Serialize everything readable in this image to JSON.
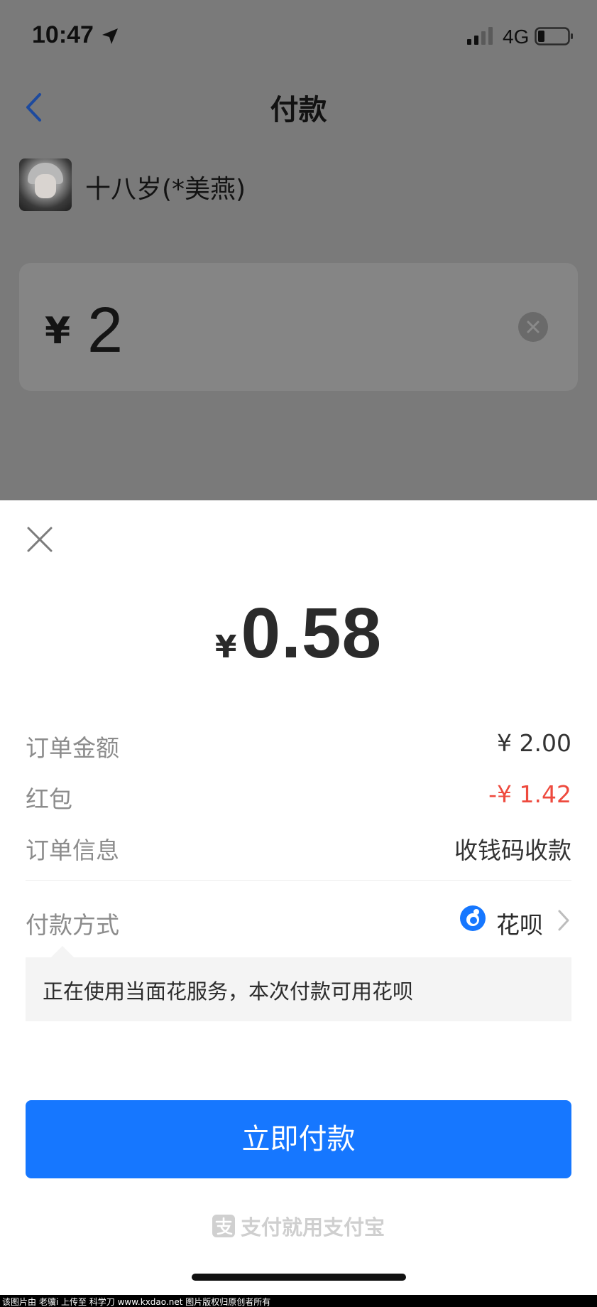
{
  "status_bar": {
    "time": "10:47",
    "network": "4G",
    "icons": [
      "location-arrow-icon",
      "signal-icon",
      "battery-icon"
    ]
  },
  "nav": {
    "title": "付款",
    "back_icon": "chevron-left-icon"
  },
  "payee": {
    "name": "十八岁(*美燕)"
  },
  "amount_input": {
    "currency": "¥",
    "value": "2"
  },
  "sheet": {
    "pay_amount": {
      "currency": "¥",
      "value": "0.58"
    },
    "details": [
      {
        "label": "订单金额",
        "value": "¥ 2.00"
      },
      {
        "label": "红包",
        "value": "-¥ 1.42"
      },
      {
        "label": "订单信息",
        "value": "收钱码收款"
      }
    ],
    "payment_method": {
      "label": "付款方式",
      "value": "花呗"
    },
    "tip": "正在使用当面花服务，本次付款可用花呗",
    "pay_button": "立即付款",
    "brand": "支付就用支付宝"
  },
  "footer": "该图片由 老骥i 上传至 科学刀 www.kxdao.net 图片版权归原创者所有",
  "colors": {
    "primary": "#1677ff",
    "discount_red": "#ee4a3e",
    "overlay_gray": "#7a7a7a"
  }
}
